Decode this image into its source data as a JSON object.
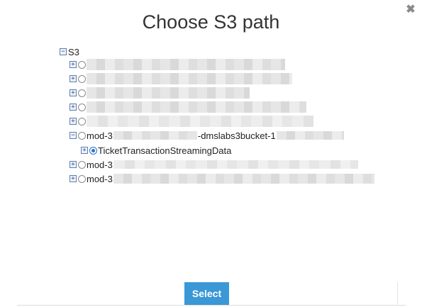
{
  "dialog": {
    "title": "Choose S3 path",
    "close_icon": "close-icon",
    "select_label": "Select"
  },
  "tree": {
    "root": {
      "label": "S3",
      "expanded": true
    },
    "items": [
      {
        "prefix": "",
        "suffix": "",
        "expanded": false,
        "selected": false,
        "redacted": true
      },
      {
        "prefix": "",
        "suffix": "",
        "expanded": false,
        "selected": false,
        "redacted": true
      },
      {
        "prefix": "",
        "suffix": "",
        "expanded": false,
        "selected": false,
        "redacted": true
      },
      {
        "prefix": "",
        "suffix": "",
        "expanded": false,
        "selected": false,
        "redacted": true
      },
      {
        "prefix": "",
        "suffix": "",
        "expanded": false,
        "selected": false,
        "redacted": true
      },
      {
        "prefix": "mod-3",
        "middle": "-dmslabs3bucket-1",
        "suffix": "",
        "expanded": true,
        "selected": false,
        "redacted": true
      },
      {
        "prefix": "mod-3",
        "suffix": "",
        "expanded": false,
        "selected": false,
        "redacted": true
      },
      {
        "prefix": "mod-3",
        "suffix": "",
        "expanded": false,
        "selected": false,
        "redacted": true
      }
    ],
    "child": {
      "label": "TicketTransactionStreamingData",
      "expanded": false,
      "selected": true
    }
  },
  "icons": {
    "expand": "⊞",
    "collapse": "⊟"
  },
  "colors": {
    "select_button": "#3a98d6",
    "radio_selected": "#2a6fd6"
  }
}
